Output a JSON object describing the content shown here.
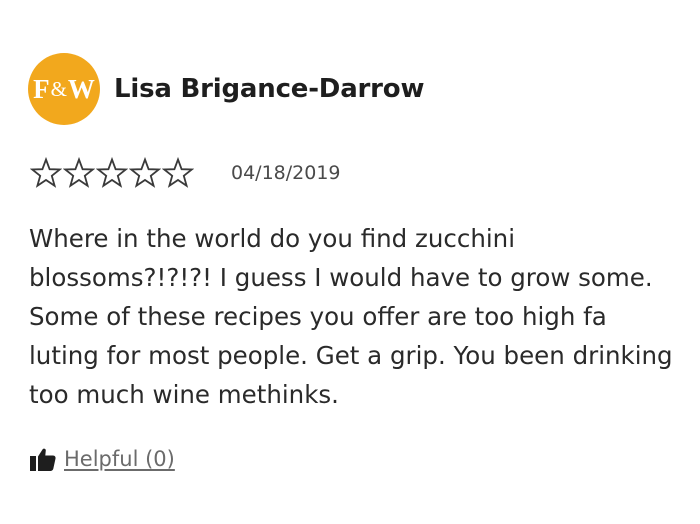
{
  "review": {
    "avatar": {
      "letter_left": "F",
      "ampersand": "&",
      "letter_right": "W"
    },
    "author": "Lisa Brigance-Darrow",
    "rating": {
      "stars_filled": 0,
      "stars_total": 5
    },
    "date": "04/18/2019",
    "text": "Where in the world do you find zucchini blossoms?!?!?! I guess I would have to grow some. Some of these recipes you offer are too high fa luting for most people. Get a grip. You been drinking too much wine methinks.",
    "helpful_label": "Helpful (0)",
    "icons": {
      "star": "star-outline-icon",
      "thumb": "thumbs-up-icon"
    },
    "colors": {
      "avatar_bg": "#f2a81d",
      "text": "#2a2a2a",
      "muted": "#6b6b6b"
    }
  }
}
